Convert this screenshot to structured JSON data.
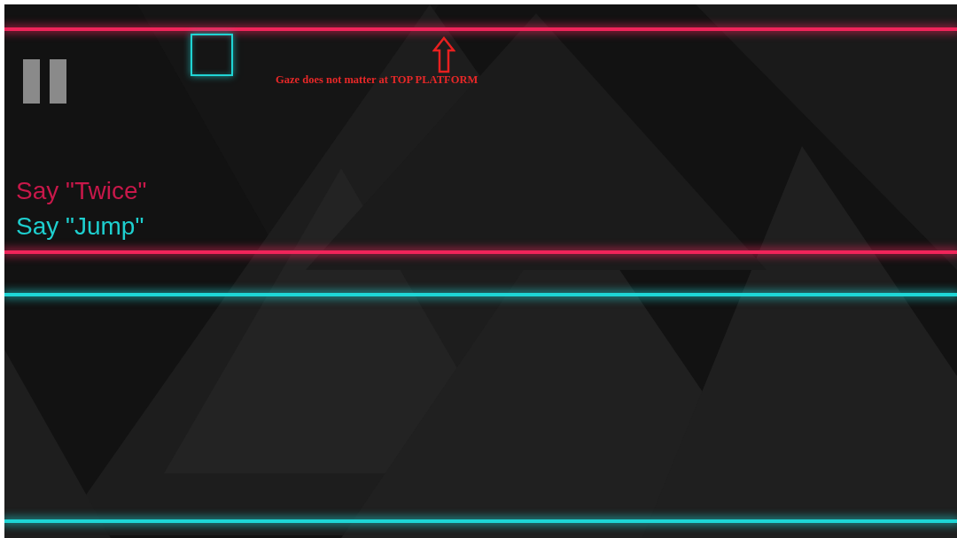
{
  "annotation": {
    "text": "Gaze does not matter at TOP PLATFORM"
  },
  "hints": [
    {
      "text": "Say \"Twice\"",
      "color": "#c8184a"
    },
    {
      "text": "Say \"Jump\"",
      "color": "#1ecfcf"
    }
  ],
  "platforms": [
    {
      "color": "#f0245a"
    },
    {
      "color": "#f0245a"
    },
    {
      "color": "#1ed6d6"
    },
    {
      "color": "#1ed6d6"
    }
  ]
}
